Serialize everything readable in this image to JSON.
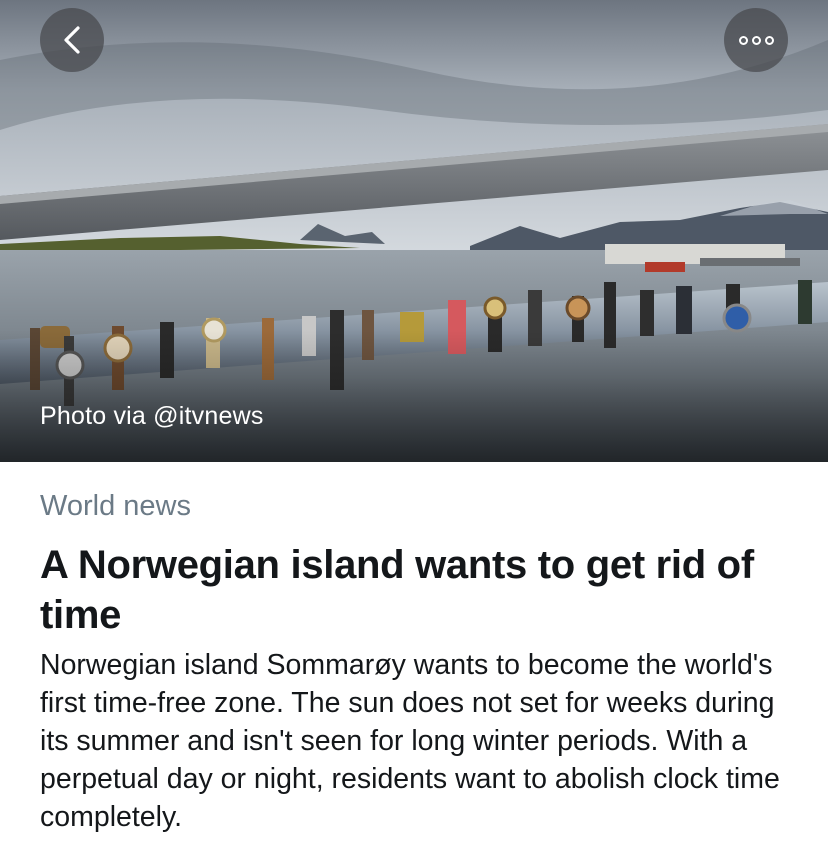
{
  "hero": {
    "caption": "Photo via @itvnews",
    "back_icon": "chevron-left-icon",
    "more_icon": "more-dots-icon"
  },
  "article": {
    "category": "World news",
    "headline": "A Norwegian island wants to get rid of time",
    "summary": "Norwegian island Sommarøy wants to become the world's first time-free zone. The sun does not set for weeks during its summer and isn't seen for long winter periods. With a perpetual day or night, residents want to abolish clock time completely."
  },
  "colors": {
    "category": "#6b7a86",
    "text": "#14171a",
    "button_bg": "#46484c"
  }
}
